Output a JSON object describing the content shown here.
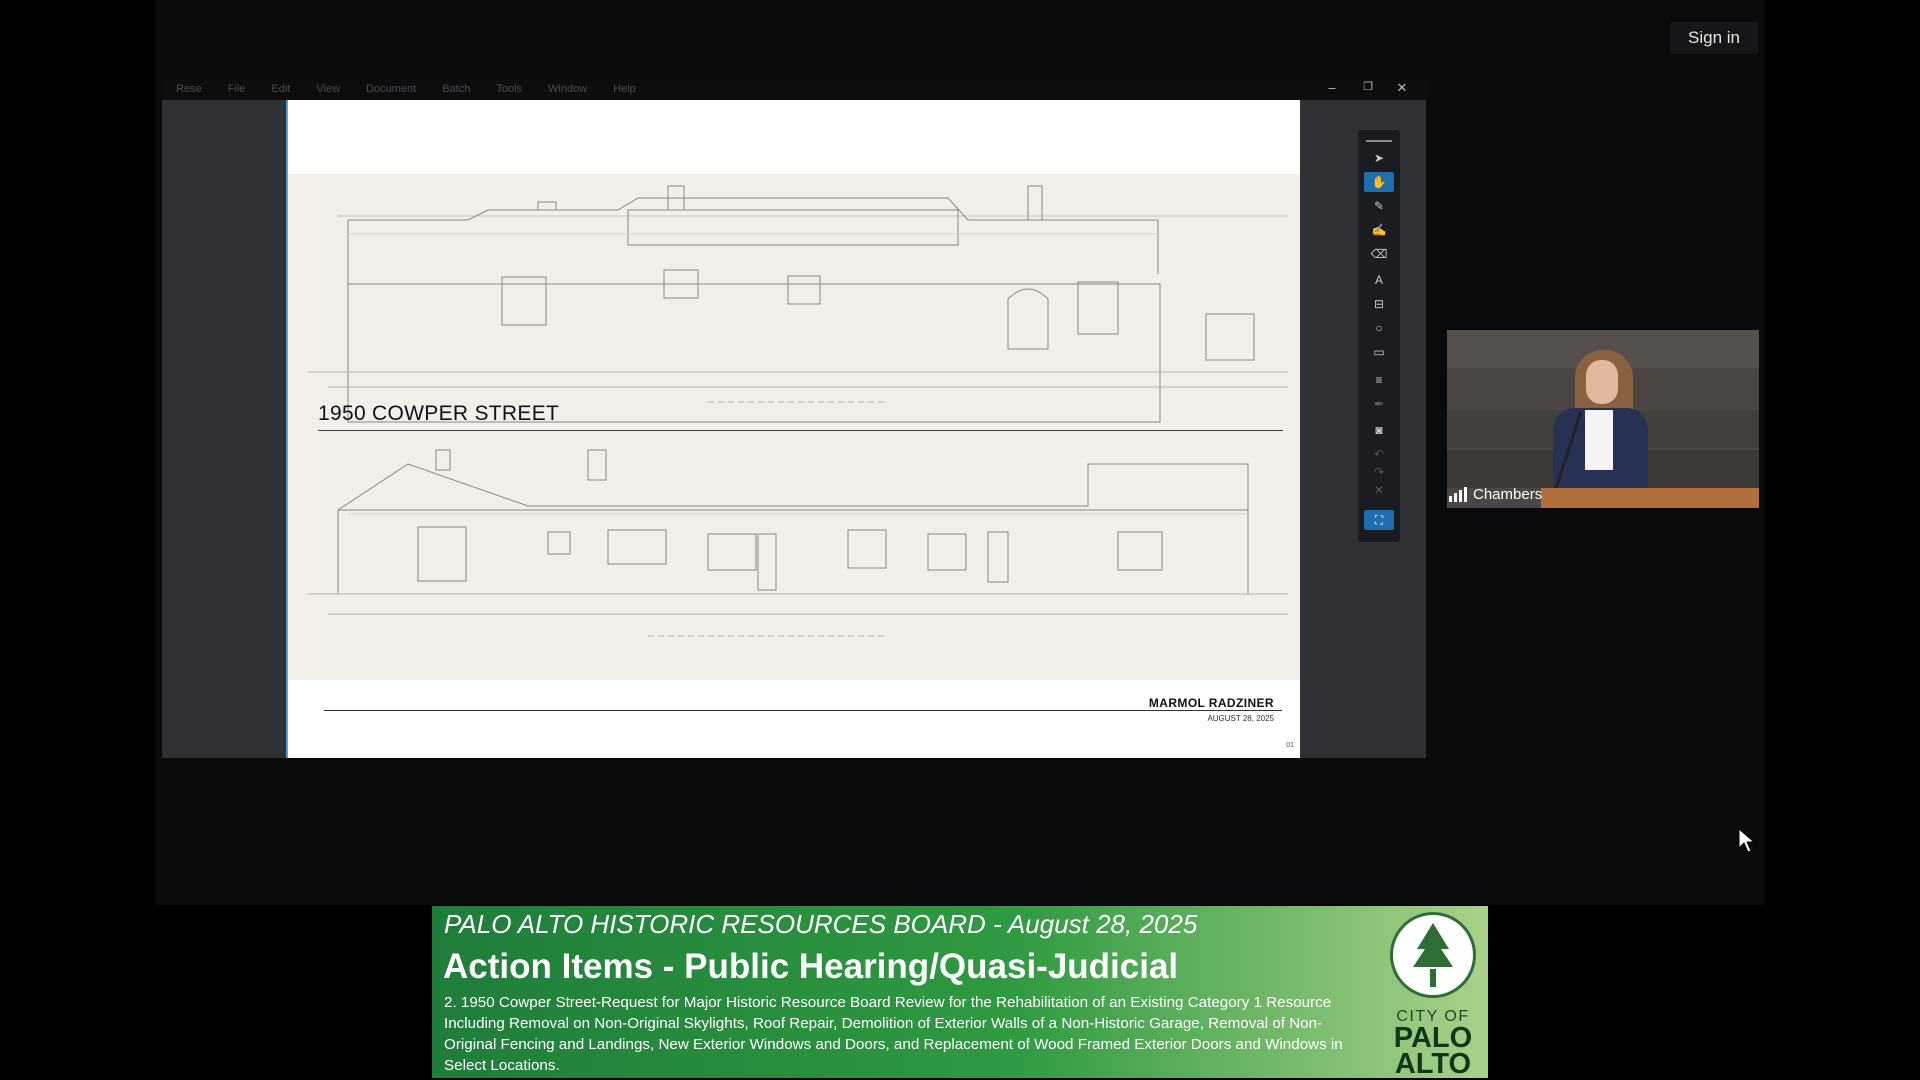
{
  "header": {
    "signin_label": "Sign in"
  },
  "app": {
    "menu": [
      "Rese",
      "File",
      "Edit",
      "View",
      "Document",
      "Batch",
      "Tools",
      "Window",
      "Help"
    ],
    "window_controls": {
      "minimize": "–",
      "restore": "❐",
      "close": "✕"
    }
  },
  "slide": {
    "title": "1950 COWPER STREET",
    "firm": "MARMOL RADZINER",
    "date": "AUGUST 28, 2025",
    "page_number": "01"
  },
  "toolbar": {
    "tools": [
      {
        "icon": "select-arrow-icon",
        "glyph": "➤"
      },
      {
        "icon": "hand-pan-icon",
        "glyph": "✋",
        "active": true
      },
      {
        "icon": "pen-icon",
        "glyph": "✎"
      },
      {
        "icon": "highlighter-icon",
        "glyph": "✍"
      },
      {
        "icon": "eraser-icon",
        "glyph": "⌫"
      },
      {
        "icon": "text-box-icon",
        "glyph": "A"
      },
      {
        "icon": "stamp-icon",
        "glyph": "⊟"
      },
      {
        "icon": "circle-shape-icon",
        "glyph": "○"
      },
      {
        "icon": "callout-icon",
        "glyph": "▭"
      },
      {
        "icon": "lines-icon",
        "glyph": "≡"
      },
      {
        "icon": "signature-icon",
        "glyph": "✒"
      },
      {
        "icon": "camera-icon",
        "glyph": "◙"
      },
      {
        "icon": "undo-icon",
        "glyph": "↶"
      },
      {
        "icon": "redo-icon",
        "glyph": "↷"
      },
      {
        "icon": "clear-icon",
        "glyph": "✕"
      },
      {
        "icon": "fullscreen-icon",
        "glyph": "⛶",
        "active": true
      }
    ]
  },
  "video": {
    "label": "Chambers"
  },
  "banner": {
    "board_line": "PALO ALTO HISTORIC RESOURCES BOARD -   August 28, 2025",
    "heading": "Action Items - Public Hearing/Quasi-Judicial",
    "description": "2. 1950 Cowper Street-Request for Major Historic Resource Board Review for the Rehabilitation of an Existing Category 1 Resource Including Removal on Non-Original Skylights, Roof Repair, Demolition of Exterior Walls of a Non-Historic Garage, Removal of Non-Original Fencing and Landings, New Exterior Windows and Doors, and Replacement of Wood  Framed Exterior Doors and Windows in Select Locations.",
    "logo_city": "CITY OF",
    "logo_palo": "PALO",
    "logo_alto": "ALTO"
  },
  "colors": {
    "banner_green": "#2f9a41",
    "toolbar_active": "#1f6fb0",
    "page_border": "#5a9bd8"
  }
}
